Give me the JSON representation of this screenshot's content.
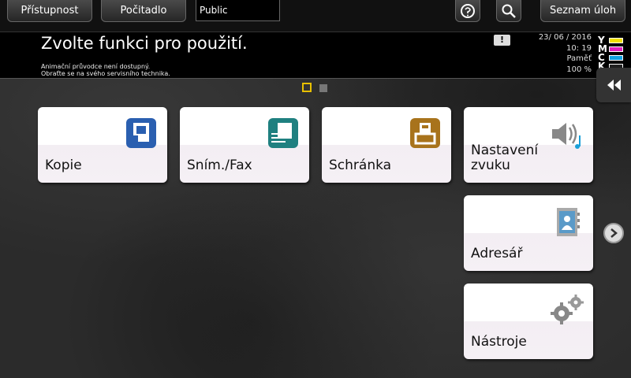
{
  "topbar": {
    "accessibility_label": "Přístupnost",
    "counter_label": "Počitadlo",
    "user": "Public",
    "job_list_label": "Seznam úloh"
  },
  "message": {
    "title": "Zvolte funkci pro použití.",
    "sub_line1": "Animační průvodce není dostupný.",
    "sub_line2": "Obraťte se na svého servisního technika."
  },
  "status": {
    "date": "23/ 06 / 2016",
    "time": "10: 19",
    "memory_label": "Paměť",
    "memory_value": "100 %"
  },
  "toner": [
    {
      "letter": "Y",
      "color": "#f0e000"
    },
    {
      "letter": "M",
      "color": "#e020c0"
    },
    {
      "letter": "C",
      "color": "#10a0e0"
    },
    {
      "letter": "K",
      "color": "#222222"
    }
  ],
  "tiles": {
    "copy": "Kopie",
    "scan_fax": "Sním./Fax",
    "box": "Schránka",
    "sound": "Nastavení zvuku",
    "address_book": "Adresář",
    "tools": "Nástroje"
  },
  "icons": {
    "copy": "copy-icon",
    "scan_fax": "scan-fax-icon",
    "box": "box-icon",
    "sound": "speaker-icon",
    "address_book": "address-book-icon",
    "tools": "gears-icon"
  }
}
